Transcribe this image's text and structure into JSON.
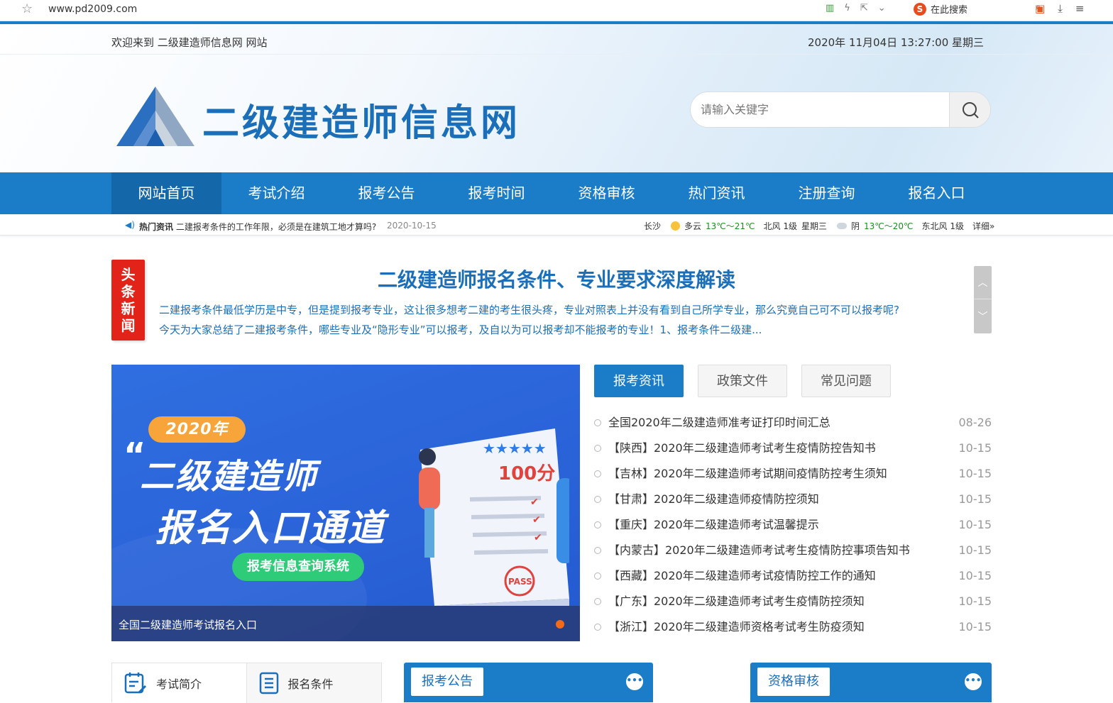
{
  "browser": {
    "url": "www.pd2009.com",
    "search_placeholder": "在此搜索"
  },
  "header": {
    "welcome": "欢迎来到 二级建造师信息网 网站",
    "datetime": "2020年 11月04日  13:27:00  星期三",
    "site_title": "二级建造师信息网",
    "search_placeholder": "请输入关键字"
  },
  "nav": {
    "items": [
      {
        "label": "网站首页"
      },
      {
        "label": "考试介绍"
      },
      {
        "label": "报考公告"
      },
      {
        "label": "报考时间"
      },
      {
        "label": "资格审核"
      },
      {
        "label": "热门资讯"
      },
      {
        "label": "注册查询"
      },
      {
        "label": "报名入口"
      }
    ]
  },
  "ticker": {
    "tag": "热门资讯",
    "text": "二建报考条件的工作年限，必须是在建筑工地才算吗?",
    "date": "2020-10-15"
  },
  "weather": {
    "city": "长沙",
    "today_cond": "多云",
    "today_temp": "13℃～21℃",
    "today_wind": "北风 1级",
    "today_day": "星期三",
    "tomorrow_cond": "阴",
    "tomorrow_temp": "13℃～20℃",
    "tomorrow_wind": "东北风 1级",
    "detail": "详细»"
  },
  "headline": {
    "badge": "头条新闻",
    "title": "二级建造师报名条件、专业要求深度解读",
    "desc_line1": "二建报考条件最低学历是中专，但是提到报考专业，这让很多想考二建的考生很头疼，专业对照表上并没有看到自己所学专业，那么究竟自己可不可以报考呢?",
    "desc_line2": "今天为大家总结了二建报考条件，哪些专业及“隐形专业”可以报考，及自以为可以报考却不能报考的专业！1、报考条件二级建..."
  },
  "banner": {
    "year": "2020年",
    "line1": "二级建造师",
    "line2": "报名入口通道",
    "button": "报考信息查询系统",
    "doc_score": "100分",
    "stamp": "PASS",
    "caption": "全国二级建造师考试报名入口"
  },
  "news_tabs": [
    {
      "label": "报考资讯"
    },
    {
      "label": "政策文件"
    },
    {
      "label": "常见问题"
    }
  ],
  "news": [
    {
      "title": "全国2020年二级建造师准考证打印时间汇总",
      "date": "08-26"
    },
    {
      "title": "【陕西】2020年二级建造师考试考生疫情防控告知书",
      "date": "10-15"
    },
    {
      "title": "【吉林】2020年二级建造师考试期间疫情防控考生须知",
      "date": "10-15"
    },
    {
      "title": "【甘肃】2020年二级建造师疫情防控须知",
      "date": "10-15"
    },
    {
      "title": "【重庆】2020年二级建造师考试温馨提示",
      "date": "10-15"
    },
    {
      "title": "【内蒙古】2020年二级建造师考试考生疫情防控事项告知书",
      "date": "10-15"
    },
    {
      "title": "【西藏】2020年二级建造师考试疫情防控工作的通知",
      "date": "10-15"
    },
    {
      "title": "【广东】2020年二级建造师考试考生疫情防控须知",
      "date": "10-15"
    },
    {
      "title": "【浙江】2020年二级建造师资格考试考生防疫须知",
      "date": "10-15"
    }
  ],
  "bottom": {
    "info_tab1": "考试简介",
    "info_tab2": "报名条件",
    "panel1": "报考公告",
    "panel2": "资格审核",
    "more": "•••"
  },
  "colors": {
    "brand_blue": "#1b7cc8",
    "badge_red": "#e2231a",
    "banner_orange": "#f7a53a",
    "banner_green": "#2ecb78"
  }
}
